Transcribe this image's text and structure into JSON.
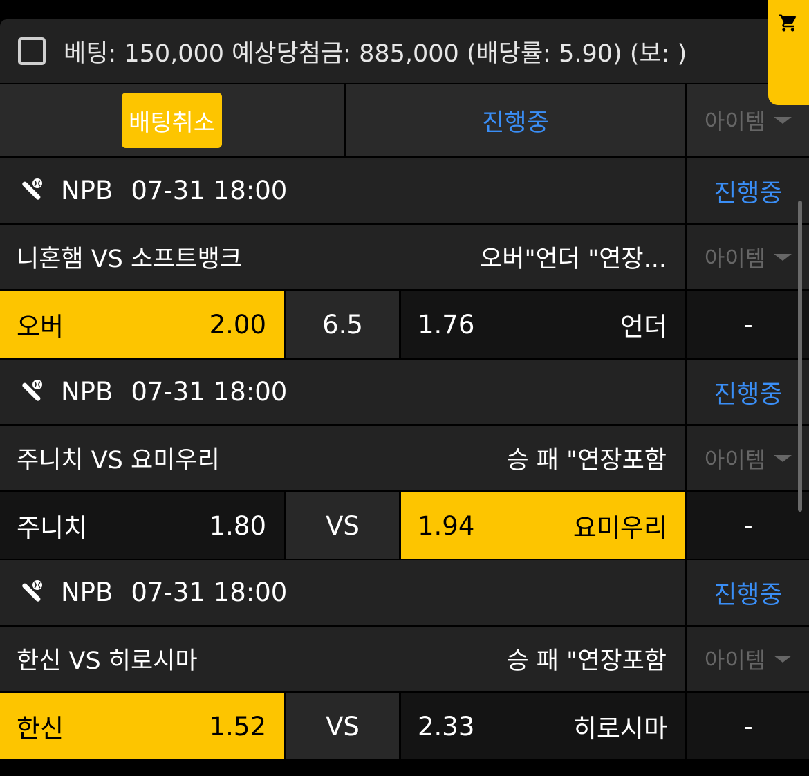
{
  "summary": {
    "text": "베팅: 150,000 예상당첨금: 885,000 (배당률: 5.90) (보: )"
  },
  "colors": {
    "accent": "#fdc500",
    "blue": "#3a8ef6",
    "muted": "#666666"
  },
  "controls": {
    "cancel_label": "배팅취소",
    "status_label": "진행중",
    "item_label": "아이템"
  },
  "games": [
    {
      "league": "NPB",
      "datetime": "07-31 18:00",
      "status": "진행중",
      "teams": "니혼햄 VS 소프트뱅크",
      "market": "오버\"언더 \"연장...",
      "item_label": "아이템",
      "left_label": "오버",
      "left_odds": "2.00",
      "middle": "6.5",
      "right_odds": "1.76",
      "right_label": "언더",
      "side": "-",
      "selected": "left"
    },
    {
      "league": "NPB",
      "datetime": "07-31 18:00",
      "status": "진행중",
      "teams": "주니치 VS 요미우리",
      "market": "승 패 \"연장포함",
      "item_label": "아이템",
      "left_label": "주니치",
      "left_odds": "1.80",
      "middle": "VS",
      "right_odds": "1.94",
      "right_label": "요미우리",
      "side": "-",
      "selected": "right"
    },
    {
      "league": "NPB",
      "datetime": "07-31 18:00",
      "status": "진행중",
      "teams": "한신 VS 히로시마",
      "market": "승 패 \"연장포함",
      "item_label": "아이템",
      "left_label": "한신",
      "left_odds": "1.52",
      "middle": "VS",
      "right_odds": "2.33",
      "right_label": "히로시마",
      "side": "-",
      "selected": "left"
    }
  ]
}
